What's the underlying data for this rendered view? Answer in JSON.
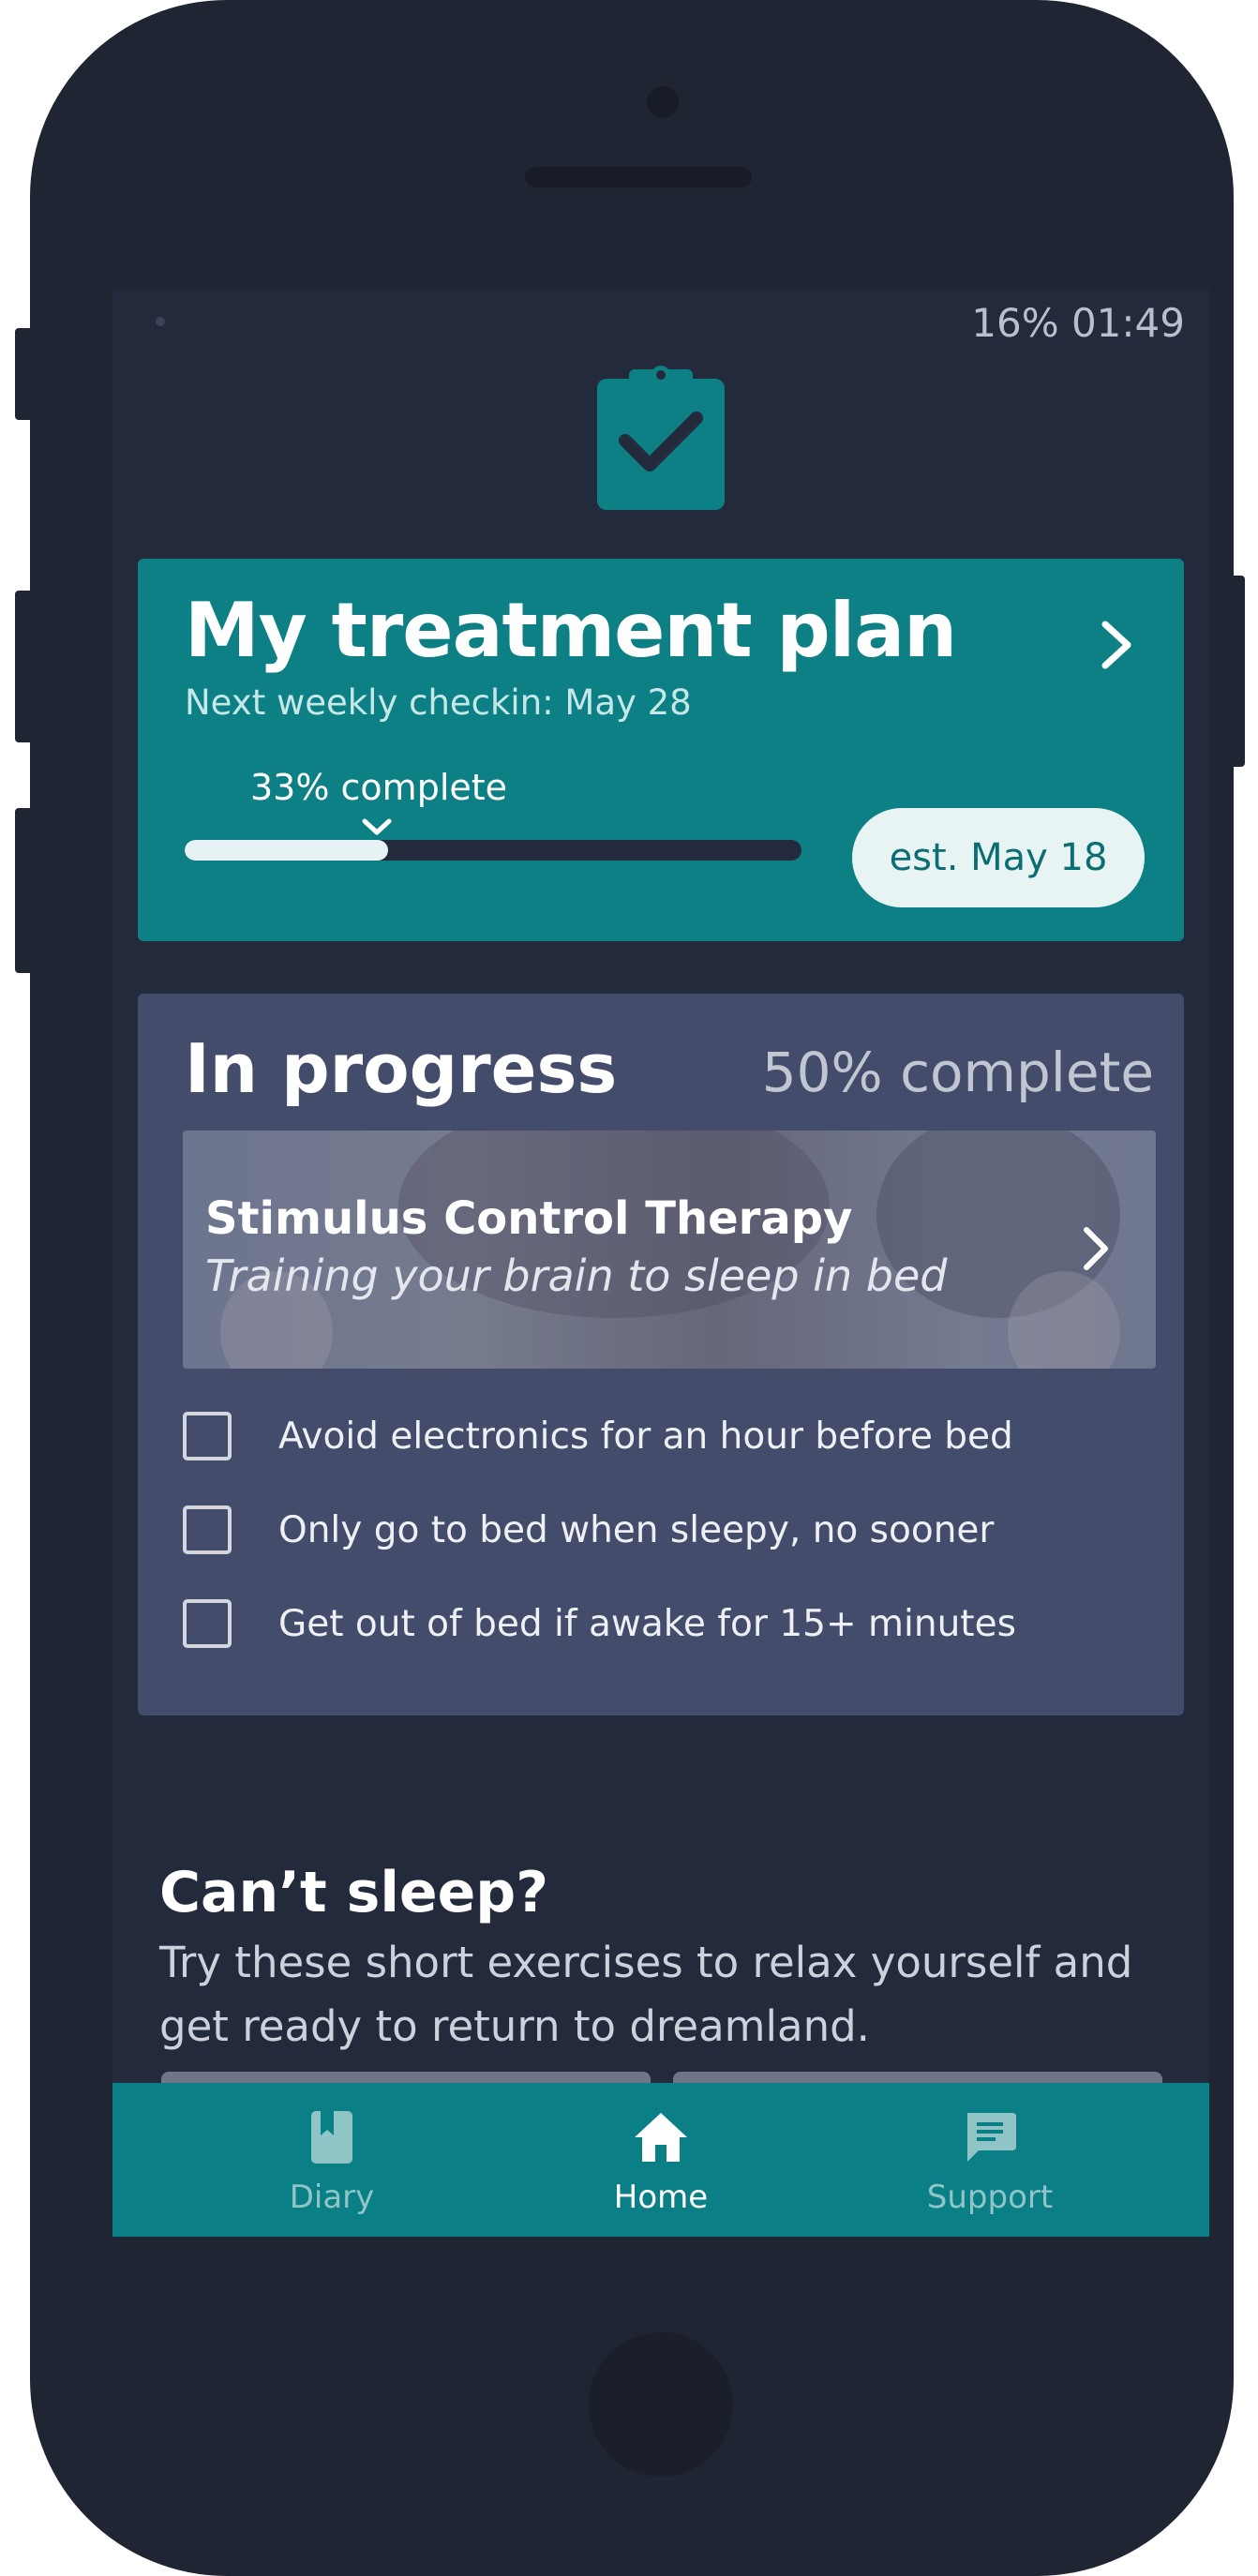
{
  "status_bar": {
    "battery_time": "16% 01:49"
  },
  "header_icon": "clipboard-check-icon",
  "treatment_plan": {
    "title": "My treatment plan",
    "subtitle": "Next weekly checkin: May 28",
    "progress_label": "33% complete",
    "progress_fraction": 0.33,
    "estimate": "est. May 18"
  },
  "in_progress": {
    "title": "In progress",
    "percent_label": "50% complete",
    "therapy": {
      "title": "Stimulus Control Therapy",
      "subtitle": "Training your brain to sleep in bed"
    },
    "tasks": [
      {
        "label": "Avoid electronics for an hour before bed",
        "checked": false
      },
      {
        "label": "Only go to bed when sleepy, no sooner",
        "checked": false
      },
      {
        "label": "Get out of bed if awake for 15+ minutes",
        "checked": false
      }
    ]
  },
  "cant_sleep": {
    "title": "Can’t sleep?",
    "subtitle": "Try these short exercises to relax yourself and get ready to return to dreamland."
  },
  "bottom_nav": {
    "items": [
      {
        "label": "Diary",
        "icon": "book-icon",
        "active": false
      },
      {
        "label": "Home",
        "icon": "home-icon",
        "active": true
      },
      {
        "label": "Support",
        "icon": "chat-icon",
        "active": false
      }
    ]
  },
  "colors": {
    "teal": "#0d8085",
    "background": "#232a3b",
    "card": "#434d6b"
  }
}
